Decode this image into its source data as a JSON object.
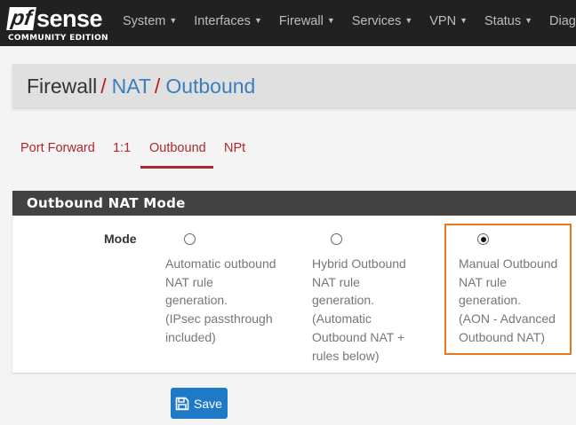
{
  "brand": {
    "logo_text": "pfsense",
    "edition": "COMMUNITY EDITION"
  },
  "nav": [
    "System",
    "Interfaces",
    "Firewall",
    "Services",
    "VPN",
    "Status",
    "Diag"
  ],
  "breadcrumb": {
    "root": "Firewall",
    "sep": "/",
    "nat": "NAT",
    "current": "Outbound"
  },
  "tabs": [
    "Port Forward",
    "1:1",
    "Outbound",
    "NPt"
  ],
  "panel": {
    "title": "Outbound NAT Mode",
    "mode_label": "Mode",
    "options": [
      {
        "label": "Automatic outbound\nNAT rule\ngeneration.\n(IPsec passthrough\nincluded)",
        "selected": false
      },
      {
        "label": "Hybrid Outbound\nNAT rule\ngeneration.\n(Automatic\nOutbound NAT +\nrules below)",
        "selected": false
      },
      {
        "label": "Manual Outbound\nNAT rule\ngeneration.\n(AON - Advanced\nOutbound NAT)",
        "selected": true
      }
    ]
  },
  "save_label": "Save",
  "colors": {
    "accent": "#b0282a",
    "link": "#3a7ebf",
    "highlight": "#e8761d",
    "button": "#1e7ac6"
  }
}
